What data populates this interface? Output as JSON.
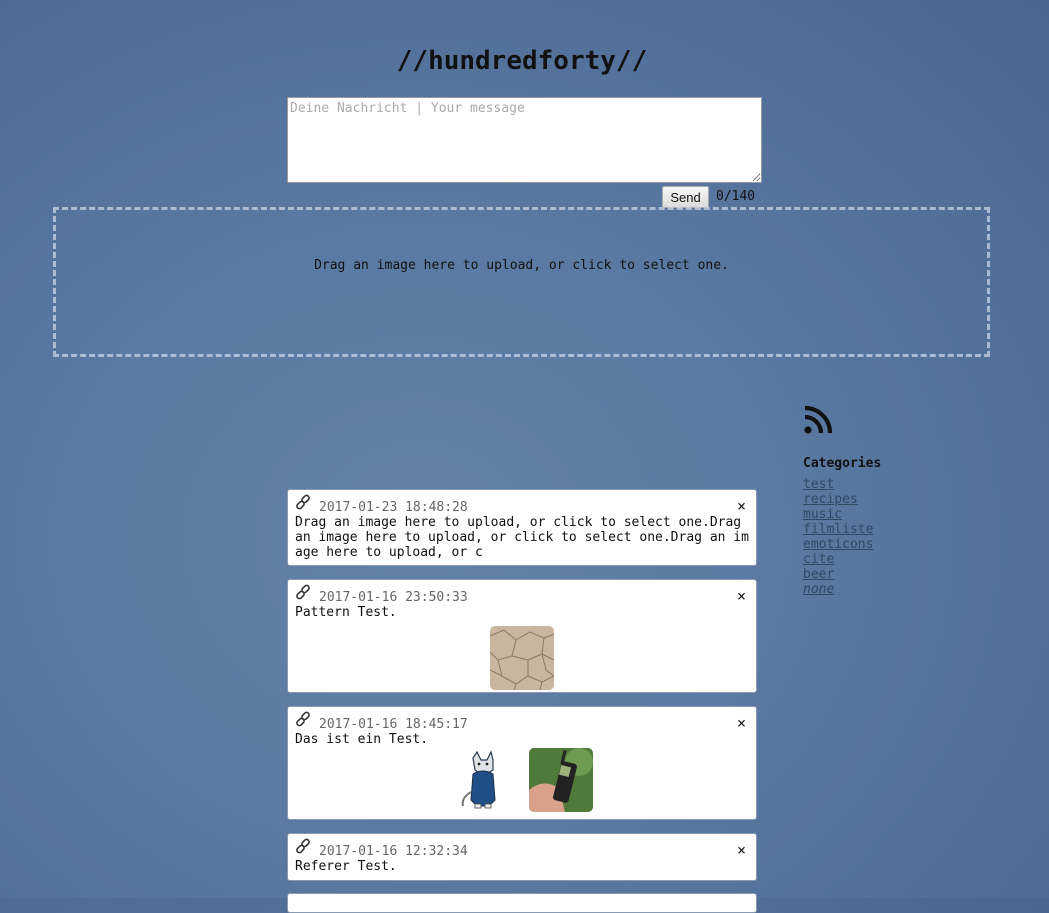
{
  "header": {
    "title": "//hundredforty//"
  },
  "composer": {
    "placeholder": "Deine Nachricht | Your message",
    "send_label": "Send",
    "counter": "0/140"
  },
  "dropzone": {
    "text": "Drag an image here to upload, or click to select one."
  },
  "sidebar": {
    "rss_icon": "rss-icon",
    "categories_title": "Categories",
    "categories": [
      "test",
      "recipes",
      "music",
      "filmliste",
      "emoticons",
      "cite",
      "beer",
      "none"
    ]
  },
  "posts": [
    {
      "timestamp": "2017-01-23 18:48:28",
      "text": "Drag an image here to upload, or click to select one.Drag an image here to upload, or click to select one.Drag an image here to upload, or c"
    },
    {
      "timestamp": "2017-01-16 23:50:33",
      "text": "Pattern Test.",
      "images": [
        "pattern-tile-image"
      ]
    },
    {
      "timestamp": "2017-01-16 18:45:17",
      "text": "Das ist ein Test.",
      "images": [
        "cat-drawing-image",
        "phone-in-hand-image"
      ]
    },
    {
      "timestamp": "2017-01-16 12:32:34",
      "text": "Referer Test."
    }
  ],
  "icons": {
    "link": "link-icon",
    "close": "close-icon",
    "close_glyph": "×"
  }
}
